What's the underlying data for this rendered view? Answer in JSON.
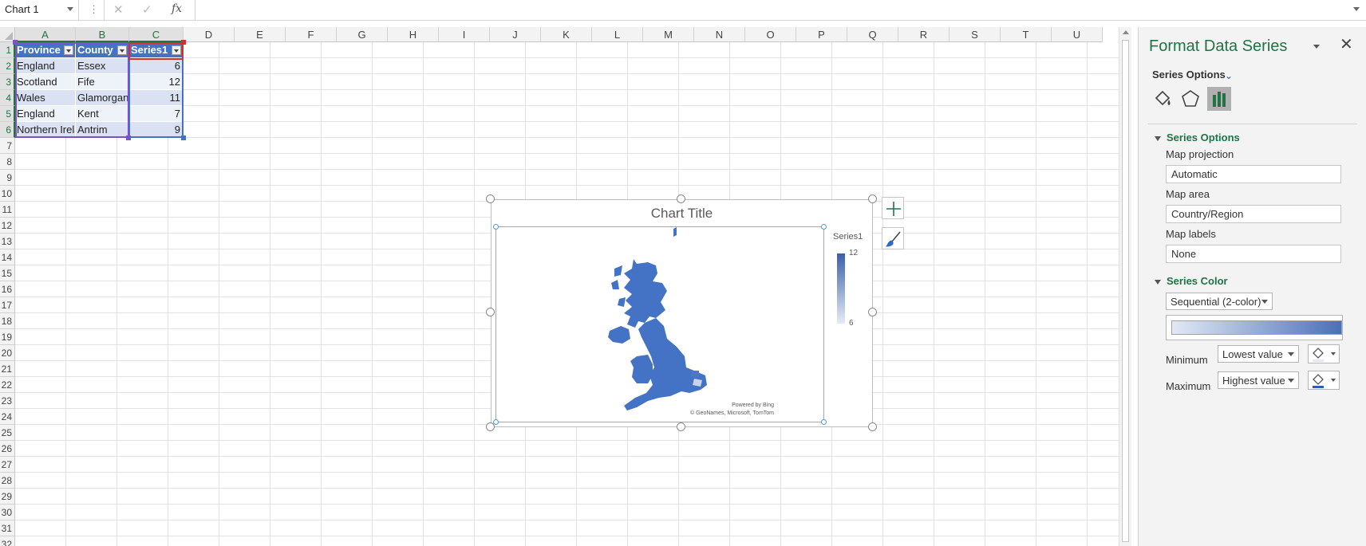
{
  "formula_bar": {
    "name_box": "Chart 1",
    "fx": "fx"
  },
  "columns": [
    "A",
    "B",
    "C",
    "D",
    "E",
    "F",
    "G",
    "H",
    "I",
    "J",
    "K",
    "L",
    "M",
    "N",
    "O",
    "P",
    "Q",
    "R",
    "S",
    "T",
    "U"
  ],
  "rows": [
    "1",
    "2",
    "3",
    "4",
    "5",
    "6",
    "7",
    "8",
    "9",
    "10",
    "11",
    "12",
    "13",
    "14",
    "15",
    "16",
    "17",
    "18",
    "19",
    "20",
    "21",
    "22",
    "23",
    "24",
    "25",
    "26",
    "27",
    "28",
    "29",
    "30",
    "31",
    "32"
  ],
  "table": {
    "headers": [
      "Province",
      "County",
      "Series1"
    ],
    "rows": [
      [
        "England",
        "Essex",
        "6"
      ],
      [
        "Scotland",
        "Fife",
        "12"
      ],
      [
        "Wales",
        "Glamorgan",
        "11"
      ],
      [
        "England",
        "Kent",
        "7"
      ],
      [
        "Northern Ireland",
        "Antrim",
        "9"
      ]
    ]
  },
  "chart": {
    "title": "Chart Title",
    "legend_title": "Series1",
    "legend_max": "12",
    "legend_min": "6",
    "attribution_1": "Powered by Bing",
    "attribution_2": "© GeoNames, Microsoft, TomTom",
    "map_color": "#4472c4",
    "buttons": [
      "chart-elements-plus-icon",
      "chart-styles-brush-icon"
    ]
  },
  "pane": {
    "title": "Format Data Series",
    "options_label": "Series Options",
    "tabs": [
      "fill-line-icon",
      "effects-pentagon-icon",
      "series-options-bar-icon"
    ],
    "section_series_options": "Series Options",
    "map_projection_label": "Map projection",
    "map_projection_value": "Automatic",
    "map_area_label": "Map area",
    "map_area_value": "Country/Region",
    "map_labels_label": "Map labels",
    "map_labels_value": "None",
    "section_series_color": "Series Color",
    "color_mode": "Sequential (2-color)",
    "minimum_label": "Minimum",
    "minimum_value": "Lowest value",
    "maximum_label": "Maximum",
    "maximum_value": "Highest value"
  }
}
